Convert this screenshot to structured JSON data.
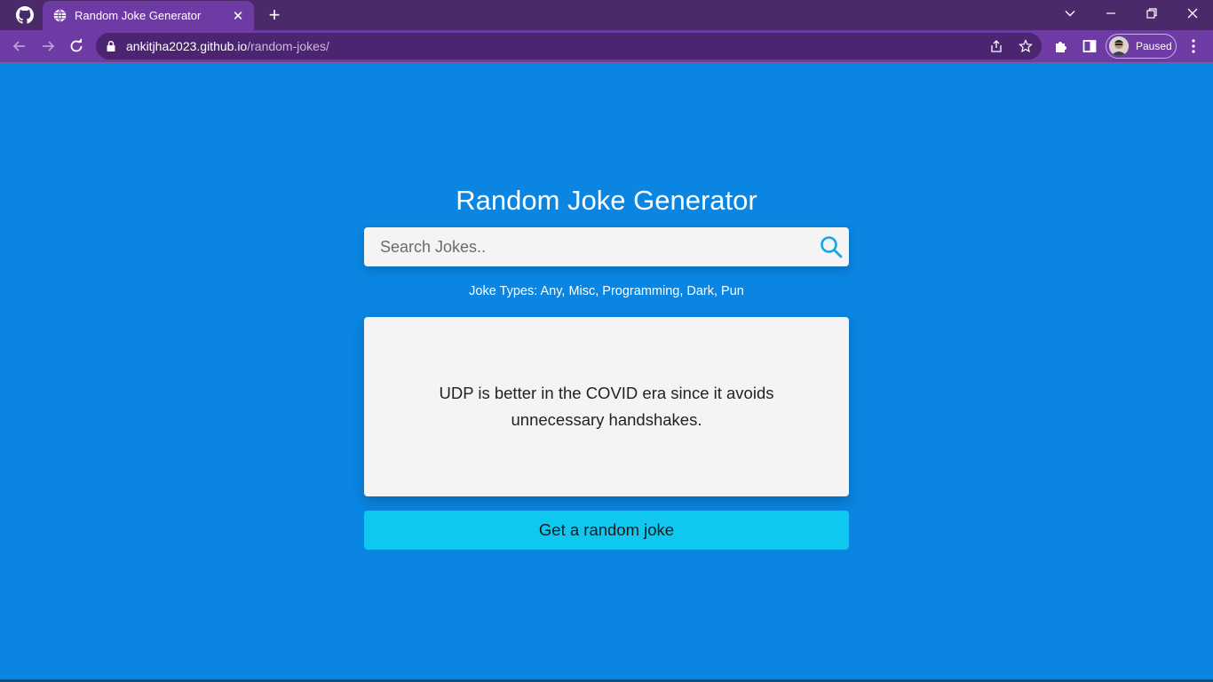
{
  "browser": {
    "tab_title": "Random Joke Generator",
    "url_host": "ankitjha2023.github.io",
    "url_path": "/random-jokes/",
    "profile_status": "Paused"
  },
  "app": {
    "title": "Random Joke Generator",
    "search_placeholder": "Search Jokes..",
    "joke_types": "Joke Types: Any, Misc, Programming, Dark, Pun",
    "joke": "UDP is better in the COVID era since it avoids unnecessary handshakes.",
    "button_label": "Get a random joke"
  },
  "colors": {
    "page_background": "#0a85e2",
    "chrome_titlebar": "#4a2a69",
    "chrome_toolbar": "#6e3aa4",
    "card_background": "#f4f4f4",
    "button_background": "#10c8ef",
    "search_icon": "#18a5e8"
  },
  "icons": {
    "github": "github-icon",
    "globe": "globe-icon",
    "search": "search-icon",
    "lock": "lock-icon",
    "share": "share-icon",
    "star": "star-icon",
    "extensions": "puzzle-icon",
    "side_panel": "side-panel-icon"
  }
}
